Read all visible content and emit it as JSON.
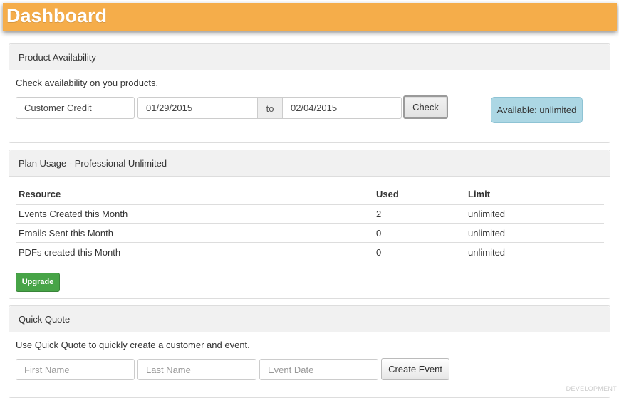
{
  "header": {
    "title": "Dashboard",
    "bg_color": "#f5ad4a"
  },
  "availability": {
    "heading": "Product Availability",
    "help": "Check availability on you products.",
    "product_value": "Customer Credit",
    "start_date": "01/29/2015",
    "to_label": "to",
    "end_date": "02/04/2015",
    "check_label": "Check",
    "result": "Available: unlimited"
  },
  "plan": {
    "heading": "Plan Usage - Professional Unlimited",
    "columns": [
      "Resource",
      "Used",
      "Limit"
    ],
    "rows": [
      [
        "Events Created this Month",
        "2",
        "unlimited"
      ],
      [
        "Emails Sent this Month",
        "0",
        "unlimited"
      ],
      [
        "PDFs created this Month",
        "0",
        "unlimited"
      ]
    ],
    "upgrade_label": "Upgrade"
  },
  "quick_quote": {
    "heading": "Quick Quote",
    "help": "Use Quick Quote to quickly create a customer and event.",
    "first_name_placeholder": "First Name",
    "last_name_placeholder": "Last Name",
    "event_date_placeholder": "Event Date",
    "create_label": "Create Event"
  },
  "watermark": "DEVELOPMENT"
}
